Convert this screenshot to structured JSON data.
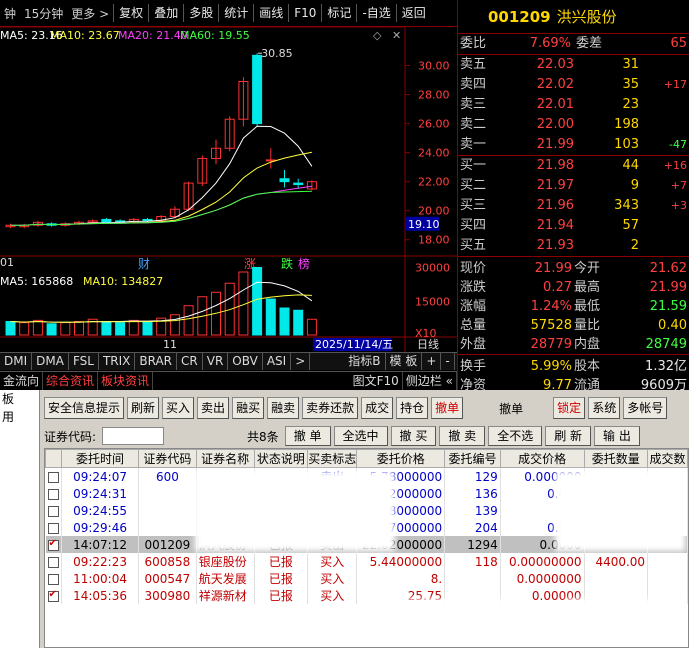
{
  "toolbar": {
    "left_labels": [
      "钟",
      "15分钟",
      "更多 >"
    ],
    "buttons": [
      "复权",
      "叠加",
      "多股",
      "统计",
      "画线",
      "F10",
      "标记",
      "-自选",
      "返回"
    ]
  },
  "chart": {
    "ma_line": {
      "ma5": "MA5: 23.16",
      "ma10": "MA10: 23.67",
      "ma20": "MA20: 21.40",
      "ma60": "MA60: 19.55"
    },
    "high_label": "30.85",
    "price_ticks": [
      "30.00",
      "28.00",
      "26.00",
      "24.00",
      "22.00",
      "20.00",
      "18.00"
    ],
    "current_price_tag": "19.10",
    "date_left": "01",
    "event_marks": [
      "财",
      "涨",
      "跌",
      "榜"
    ],
    "vol_ma_line": {
      "ma5": "MA5: 165868",
      "ma10": "MA10: 134827"
    },
    "vol_ticks": [
      "30000",
      "15000",
      "X10"
    ],
    "date_mid": "11",
    "date_cursor": "2025/11/14/五",
    "date_unit": "日线",
    "colors": {
      "up": "#ff3030",
      "down": "#00e8e8",
      "ma5": "#ffffff",
      "ma10": "#ffff40",
      "ma20": "#ff40ff",
      "ma60": "#40ff40"
    }
  },
  "chart_data": {
    "type": "candlestick",
    "price_range": [
      17.5,
      31
    ],
    "candles": [
      {
        "o": 18.9,
        "c": 19.0,
        "h": 19.1,
        "l": 18.8
      },
      {
        "o": 18.9,
        "c": 19.0,
        "h": 19.1,
        "l": 18.8
      },
      {
        "o": 19.0,
        "c": 19.2,
        "h": 19.3,
        "l": 18.9
      },
      {
        "o": 19.1,
        "c": 19.0,
        "h": 19.2,
        "l": 18.9
      },
      {
        "o": 19.0,
        "c": 19.1,
        "h": 19.2,
        "l": 18.9
      },
      {
        "o": 19.1,
        "c": 19.2,
        "h": 19.3,
        "l": 19.0
      },
      {
        "o": 19.2,
        "c": 19.3,
        "h": 19.4,
        "l": 19.1
      },
      {
        "o": 19.4,
        "c": 19.2,
        "h": 19.5,
        "l": 19.1
      },
      {
        "o": 19.3,
        "c": 19.2,
        "h": 19.4,
        "l": 19.1
      },
      {
        "o": 19.2,
        "c": 19.4,
        "h": 19.5,
        "l": 19.1
      },
      {
        "o": 19.4,
        "c": 19.3,
        "h": 19.5,
        "l": 19.2
      },
      {
        "o": 19.3,
        "c": 19.6,
        "h": 19.7,
        "l": 19.2
      },
      {
        "o": 19.6,
        "c": 20.1,
        "h": 20.3,
        "l": 19.5
      },
      {
        "o": 20.1,
        "c": 21.9,
        "h": 22.0,
        "l": 20.0
      },
      {
        "o": 21.9,
        "c": 23.6,
        "h": 23.8,
        "l": 21.7
      },
      {
        "o": 23.6,
        "c": 24.3,
        "h": 24.9,
        "l": 23.2
      },
      {
        "o": 24.3,
        "c": 26.3,
        "h": 26.5,
        "l": 24.1
      },
      {
        "o": 26.3,
        "c": 28.9,
        "h": 29.2,
        "l": 25.8
      },
      {
        "o": 30.7,
        "c": 26.0,
        "h": 30.85,
        "l": 25.8
      },
      {
        "o": 23.5,
        "c": 23.5,
        "h": 24.3,
        "l": 22.9
      },
      {
        "o": 22.2,
        "c": 22.0,
        "h": 22.8,
        "l": 21.6
      },
      {
        "o": 21.9,
        "c": 21.8,
        "h": 22.2,
        "l": 21.5
      },
      {
        "o": 21.5,
        "c": 22.0,
        "h": 22.1,
        "l": 21.4
      }
    ],
    "volumes": [
      60,
      55,
      65,
      50,
      55,
      60,
      70,
      60,
      55,
      65,
      60,
      75,
      90,
      130,
      170,
      190,
      230,
      280,
      300,
      160,
      120,
      110,
      70
    ],
    "vol_up": [
      false,
      true,
      true,
      false,
      true,
      true,
      true,
      false,
      false,
      true,
      false,
      true,
      true,
      true,
      true,
      true,
      true,
      true,
      false,
      false,
      false,
      false,
      true
    ]
  },
  "indicator_tabs": [
    "DMI",
    "DMA",
    "FSL",
    "TRIX",
    "BRAR",
    "CR",
    "VR",
    "OBV",
    "ASI",
    ">",
    "指标B",
    "模 板",
    "+",
    "-"
  ],
  "info_tabs": [
    "金流向",
    "综合资讯",
    "板块资讯",
    "图文F10",
    "侧边栏 «"
  ],
  "quote": {
    "code": "001209",
    "name": "洪兴股份",
    "weibi_label": "委比",
    "weibi": "7.69%",
    "weicha_label": "委差",
    "weicha": "65",
    "sells": [
      {
        "label": "卖五",
        "price": "22.03",
        "vol": "31",
        "chg": ""
      },
      {
        "label": "卖四",
        "price": "22.02",
        "vol": "35",
        "chg": "+17"
      },
      {
        "label": "卖三",
        "price": "22.01",
        "vol": "23",
        "chg": ""
      },
      {
        "label": "卖二",
        "price": "22.00",
        "vol": "198",
        "chg": ""
      },
      {
        "label": "卖一",
        "price": "21.99",
        "vol": "103",
        "chg": "-47"
      }
    ],
    "buys": [
      {
        "label": "买一",
        "price": "21.98",
        "vol": "44",
        "chg": "+16"
      },
      {
        "label": "买二",
        "price": "21.97",
        "vol": "9",
        "chg": "+7"
      },
      {
        "label": "买三",
        "price": "21.96",
        "vol": "343",
        "chg": "+3"
      },
      {
        "label": "买四",
        "price": "21.94",
        "vol": "57",
        "chg": ""
      },
      {
        "label": "买五",
        "price": "21.93",
        "vol": "2",
        "chg": ""
      }
    ],
    "fields1": [
      {
        "l1": "现价",
        "v1": "21.99",
        "c1": "red",
        "l2": "今开",
        "v2": "21.62",
        "c2": "red"
      },
      {
        "l1": "涨跌",
        "v1": "0.27",
        "c1": "red",
        "l2": "最高",
        "v2": "21.99",
        "c2": "red"
      },
      {
        "l1": "涨幅",
        "v1": "1.24%",
        "c1": "red",
        "l2": "最低",
        "v2": "21.59",
        "c2": "grn"
      },
      {
        "l1": "总量",
        "v1": "57528",
        "c1": "yel",
        "l2": "量比",
        "v2": "0.40",
        "c2": "yel"
      },
      {
        "l1": "外盘",
        "v1": "28779",
        "c1": "red",
        "l2": "内盘",
        "v2": "28749",
        "c2": "grn"
      }
    ],
    "fields2": [
      {
        "l1": "换手",
        "v1": "5.99%",
        "c1": "yel",
        "l2": "股本",
        "v2": "1.32亿",
        "c2": "wht"
      },
      {
        "l1": "净资",
        "v1": "9.77",
        "c1": "yel",
        "l2": "流通",
        "v2": "9609万",
        "c2": "wht"
      }
    ]
  },
  "leftnav": [
    "板",
    "用"
  ],
  "trade_buttons": [
    {
      "label": "安全信息提示",
      "red": false
    },
    {
      "label": "刷新",
      "red": false
    },
    {
      "label": "买入",
      "red": false
    },
    {
      "label": "卖出",
      "red": false
    },
    {
      "label": "融买",
      "red": false
    },
    {
      "label": "融卖",
      "red": false
    },
    {
      "label": "卖券还款",
      "red": false
    },
    {
      "label": "成交",
      "red": false
    },
    {
      "label": "持仓",
      "red": false
    },
    {
      "label": "撤单",
      "red": true
    }
  ],
  "trade_title": "撤单",
  "trade_right_buttons": [
    {
      "label": "锁定",
      "red": true
    },
    {
      "label": "系统",
      "red": false
    },
    {
      "label": "多帐号",
      "red": false
    }
  ],
  "search": {
    "code_label": "证券代码:",
    "count": "共8条",
    "actions": [
      "撤 单",
      "全选中",
      "撤 买",
      "撤 卖",
      "全不选",
      "刷 新",
      "输 出"
    ]
  },
  "table": {
    "headers": [
      "",
      "委托时间",
      "证券代码",
      "证券名称",
      "状态说明",
      "买卖标志",
      "委托价格",
      "委托编号",
      "成交价格",
      "委托数量",
      "成交数"
    ],
    "rows": [
      {
        "checked": false,
        "sel": false,
        "color": "tblue",
        "time": "09:24:07",
        "code": "600",
        "name": "",
        "status": "",
        "side": "卖出",
        "price": "5.78000000",
        "no": "129",
        "dprice": "0.000000",
        "qty": "",
        "dqty": ""
      },
      {
        "checked": false,
        "sel": false,
        "color": "tblue",
        "time": "09:24:31",
        "code": "",
        "name": "",
        "status": "",
        "side": "卖出",
        "price": "6.42000000",
        "no": "136",
        "dprice": "0.000",
        "qty": "",
        "dqty": ""
      },
      {
        "checked": false,
        "sel": false,
        "color": "tblue",
        "time": "09:24:55",
        "code": "",
        "name": "",
        "status": "",
        "side": "卖出",
        "price": "14.78000000",
        "no": "139",
        "dprice": "0",
        "qty": "",
        "dqty": ""
      },
      {
        "checked": false,
        "sel": false,
        "color": "tblue",
        "time": "09:29:46",
        "code": "",
        "name": "",
        "status": "",
        "side": "卖出",
        "price": "6.57000000",
        "no": "204",
        "dprice": "0.000",
        "qty": "00",
        "dqty": ""
      },
      {
        "checked": true,
        "sel": true,
        "color": "tblk",
        "time": "14:07:12",
        "code": "001209",
        "name": "洪兴股份",
        "status": "已报",
        "side": "卖出",
        "price": "22.02000000",
        "no": "1294",
        "dprice": "0.0000",
        "qty": "",
        "dqty": ""
      },
      {
        "checked": false,
        "sel": false,
        "color": "tred",
        "time": "09:22:23",
        "code": "600858",
        "name": "银座股份",
        "status": "已报",
        "side": "买入",
        "price": "5.44000000",
        "no": "118",
        "dprice": "0.00000000",
        "qty": "4400.00",
        "dqty": ""
      },
      {
        "checked": false,
        "sel": false,
        "color": "tred",
        "time": "11:00:04",
        "code": "000547",
        "name": "航天发展",
        "status": "已报",
        "side": "买入",
        "price": "8.",
        "no": "",
        "dprice": "0.0000000",
        "qty": "",
        "dqty": ""
      },
      {
        "checked": true,
        "sel": false,
        "color": "tred",
        "time": "14:05:36",
        "code": "300980",
        "name": "祥源新材",
        "status": "已报",
        "side": "买入",
        "price": "25.75",
        "no": "",
        "dprice": "0.00000",
        "qty": "",
        "dqty": ""
      }
    ]
  }
}
